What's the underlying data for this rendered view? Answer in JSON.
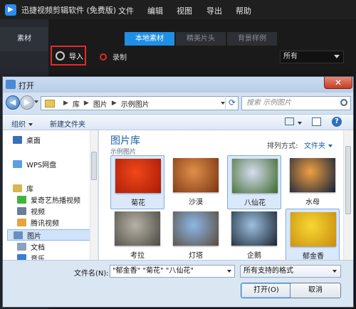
{
  "app": {
    "title": "迅捷视频剪辑软件 (免费版)",
    "menu": [
      "文件",
      "编辑",
      "视图",
      "导出",
      "帮助"
    ],
    "sidebar_tab": "素材",
    "source_tabs": [
      "本地素材",
      "精美片头",
      "背景样例"
    ],
    "active_source_tab": 0,
    "import_label": "导入",
    "record_label": "录制",
    "filter_value": "所有"
  },
  "dialog": {
    "title": "打开",
    "close_glyph": "✕",
    "breadcrumb": [
      "库",
      "图片",
      "示例图片"
    ],
    "search_placeholder": "搜索 示例图片",
    "organize_label": "组织",
    "new_folder_label": "新建文件夹",
    "help_glyph": "?",
    "nav_items": [
      {
        "label": "桌面",
        "icon": "desktop-icon",
        "color": "#3b6fb3"
      },
      {
        "label": "WPS网盘",
        "icon": "cloud-icon",
        "color": "#5aa0e0"
      },
      {
        "label": "库",
        "icon": "library-icon",
        "color": "#d9b650"
      },
      {
        "label": "爱奇艺热播视频",
        "icon": "iqiyi-icon",
        "color": "#3fb540"
      },
      {
        "label": "视频",
        "icon": "video-folder-icon",
        "color": "#6a7f96"
      },
      {
        "label": "腾讯视频",
        "icon": "tencent-video-icon",
        "color": "#e8a43a"
      },
      {
        "label": "图片",
        "icon": "pictures-folder-icon",
        "color": "#6a8fbf",
        "selected": true
      },
      {
        "label": "文档",
        "icon": "documents-folder-icon",
        "color": "#8aa2bf"
      },
      {
        "label": "音乐",
        "icon": "music-folder-icon",
        "color": "#3b7dd0"
      }
    ],
    "library_title": "图片库",
    "library_subtitle": "示例图片",
    "sort_label": "排列方式:",
    "sort_value": "文件夹",
    "thumbnails": [
      {
        "label": "菊花",
        "selected": true,
        "colors": [
          "#f04818",
          "#a81a08"
        ]
      },
      {
        "label": "沙漠",
        "selected": false,
        "colors": [
          "#e0904a",
          "#7a3414"
        ]
      },
      {
        "label": "八仙花",
        "selected": true,
        "colors": [
          "#d8dcf0",
          "#3c6a2c"
        ]
      },
      {
        "label": "水母",
        "selected": false,
        "colors": [
          "#f0a040",
          "#10203c"
        ]
      },
      {
        "label": "考拉",
        "selected": false,
        "colors": [
          "#b8b2a8",
          "#4a4a40"
        ]
      },
      {
        "label": "灯塔",
        "selected": false,
        "colors": [
          "#8cb8e8",
          "#5a4a3a"
        ]
      },
      {
        "label": "企鹅",
        "selected": false,
        "colors": [
          "#9cc0e0",
          "#1a2430"
        ]
      },
      {
        "label": "郁金香",
        "selected": true,
        "colors": [
          "#f8d830",
          "#c88a10"
        ]
      }
    ],
    "filename_label": "文件名(N):",
    "filename_value": "\"郁金香\" \"菊花\" \"八仙花\"",
    "filetype_value": "所有支持的格式",
    "open_button": "打开(O)",
    "cancel_button": "取消"
  }
}
